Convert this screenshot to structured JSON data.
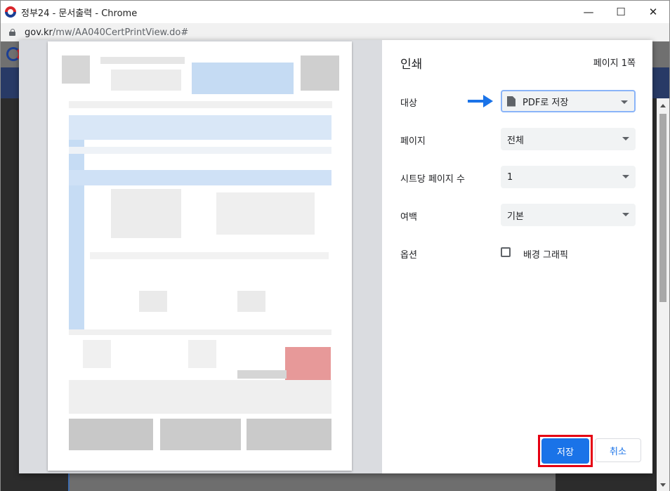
{
  "window": {
    "title": "정부24 - 문서출력 - Chrome",
    "controls": {
      "minimize": "—",
      "maximize": "☐",
      "close": "✕"
    }
  },
  "address_bar": {
    "host": "gov.kr",
    "path": "/mw/AA040CertPrintView.do#"
  },
  "print_dialog": {
    "heading": "인쇄",
    "page_count": "페이지 1쪽",
    "destination": {
      "label": "대상",
      "value": "PDF로 저장"
    },
    "pages": {
      "label": "페이지",
      "value": "전체"
    },
    "pages_per_sheet": {
      "label": "시트당 페이지 수",
      "value": "1"
    },
    "margins": {
      "label": "여백",
      "value": "기본"
    },
    "options": {
      "label": "옵션",
      "checkbox_label": "배경 그래픽",
      "checked": false
    },
    "save_button": "저장",
    "cancel_button": "취소"
  },
  "colors": {
    "accent": "#1a73e8",
    "highlight_box": "#e50012",
    "arrow": "#1a73e8",
    "background_nav": "#283a66"
  }
}
